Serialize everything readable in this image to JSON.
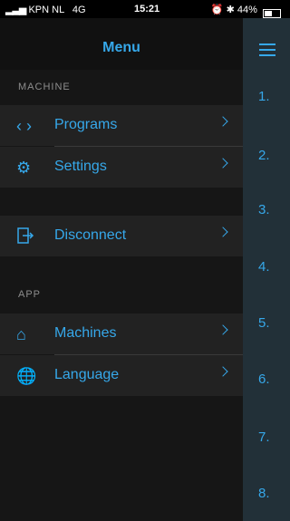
{
  "status": {
    "carrier": "KPN NL",
    "network": "4G",
    "time": "15:21",
    "battery": "44%"
  },
  "menu": {
    "title": "Menu",
    "sections": [
      {
        "label": "MACHINE"
      },
      {
        "label": "APP"
      }
    ],
    "items": [
      {
        "label": "Programs",
        "icon": "code-brackets-icon"
      },
      {
        "label": "Settings",
        "icon": "gear-icon"
      },
      {
        "label": "Disconnect",
        "icon": "exit-icon"
      },
      {
        "label": "Machines",
        "icon": "house-icon"
      },
      {
        "label": "Language",
        "icon": "globe-icon"
      }
    ]
  },
  "steps": [
    "1.",
    "2.",
    "3.",
    "4.",
    "5.",
    "6.",
    "7.",
    "8."
  ],
  "colors": {
    "accent": "#36a8ea",
    "menu_bg": "#161616",
    "row_bg": "#222222",
    "side_bg": "#223038"
  }
}
